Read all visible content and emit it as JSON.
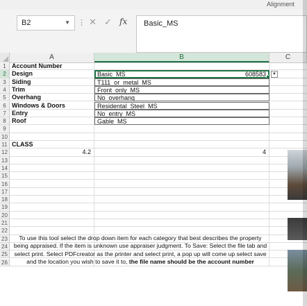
{
  "ribbon": {
    "label_left": "",
    "label_alignment": "Alignment"
  },
  "formula_bar": {
    "name_box": "B2",
    "formula": "Basic_MS"
  },
  "columns": {
    "a": "A",
    "b": "B",
    "c": "C"
  },
  "rows": [
    {
      "n": "1",
      "a": "Account Number",
      "b": "",
      "bold": true
    },
    {
      "n": "2",
      "a": "Design",
      "b": "Basic_MS",
      "b_value": "608583",
      "bold": true
    },
    {
      "n": "3",
      "a": "Siding",
      "b": "T111_or_metal_MS",
      "bold": true
    },
    {
      "n": "4",
      "a": "Trim",
      "b": "Front_only_MS",
      "bold": true
    },
    {
      "n": "5",
      "a": "Overhang",
      "b": "No_overhang",
      "bold": true
    },
    {
      "n": "6",
      "a": "Windows & Doors",
      "b": "Residental_Steel_MS",
      "bold": true
    },
    {
      "n": "7",
      "a": "Entry",
      "b": "No_entry_MS",
      "bold": true
    },
    {
      "n": "8",
      "a": "Roof",
      "b": "Gable_MS",
      "bold": true
    },
    {
      "n": "9",
      "a": "",
      "b": ""
    },
    {
      "n": "10",
      "a": "",
      "b": ""
    },
    {
      "n": "11",
      "a": "CLASS",
      "b": "",
      "bold": true
    },
    {
      "n": "12",
      "a": "4.2",
      "b": "4"
    },
    {
      "n": "13",
      "a": "",
      "b": ""
    },
    {
      "n": "14",
      "a": "",
      "b": ""
    },
    {
      "n": "15",
      "a": "",
      "b": ""
    },
    {
      "n": "16",
      "a": "",
      "b": ""
    },
    {
      "n": "17",
      "a": "",
      "b": ""
    },
    {
      "n": "18",
      "a": "",
      "b": ""
    },
    {
      "n": "19",
      "a": "",
      "b": ""
    },
    {
      "n": "20",
      "a": "",
      "b": ""
    },
    {
      "n": "21",
      "a": "",
      "b": ""
    },
    {
      "n": "22",
      "a": "",
      "b": ""
    },
    {
      "n": "23",
      "a": "",
      "b": ""
    },
    {
      "n": "24",
      "a": "",
      "b": ""
    },
    {
      "n": "25",
      "a": "",
      "b": ""
    },
    {
      "n": "26",
      "a": "",
      "b": ""
    }
  ],
  "note": {
    "text": "To use this tool select the drop down item for each category that best describes the property being appraised.  If the item is unknown use appraiser judgment. To Save: Select the file tab and select print.  Select PDFcreator as the printer and select print, a pop up will come up select save and the location you wish to save it to, ",
    "bold_text": "the file name should be the account number"
  }
}
